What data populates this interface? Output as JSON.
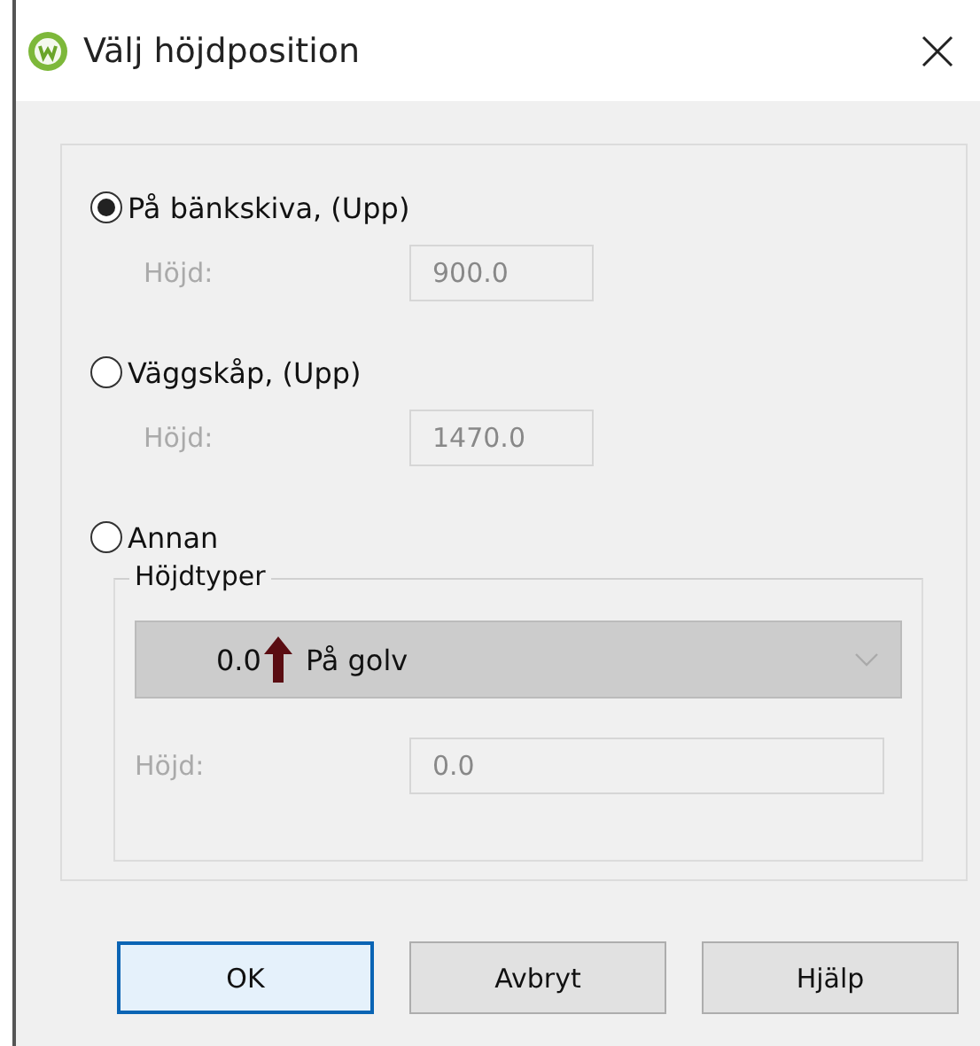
{
  "window": {
    "title": "Välj höjdposition"
  },
  "options": [
    {
      "label": "På bänkskiva, (Upp)",
      "selected": true,
      "height": {
        "label": "Höjd:",
        "value": "900.0",
        "disabled": true
      }
    },
    {
      "label": "Väggskåp, (Upp)",
      "selected": false,
      "height": {
        "label": "Höjd:",
        "value": "1470.0",
        "disabled": true
      }
    },
    {
      "label": "Annan",
      "selected": false
    }
  ],
  "height_types": {
    "title": "Höjdtyper",
    "combo": {
      "value": "0.0",
      "label": "På golv",
      "disabled": true
    },
    "height": {
      "label": "Höjd:",
      "value": "0.0",
      "disabled": true
    }
  },
  "buttons": [
    {
      "label": "OK",
      "default": true
    },
    {
      "label": "Avbryt",
      "default": false
    },
    {
      "label": "Hjälp",
      "default": false
    }
  ]
}
